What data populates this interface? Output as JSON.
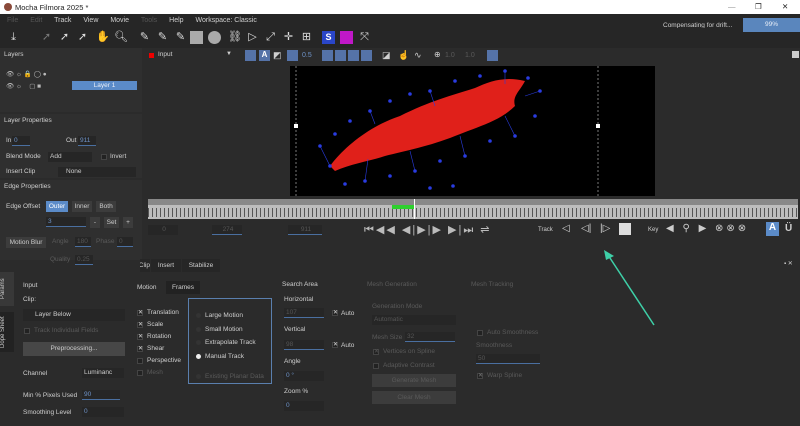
{
  "window": {
    "title": "Mocha Filmora 2025 *",
    "min": "—",
    "max": "❐",
    "close": "✕"
  },
  "menu": [
    "File",
    "Edit",
    "Track",
    "View",
    "Movie",
    "Tools",
    "Help"
  ],
  "workspace": "Workspace: Classic",
  "status": {
    "text": "Compensating for drift...",
    "progress_label": "99%",
    "progress": 99
  },
  "layers": {
    "title": "Layers",
    "items": [
      {
        "name": "Layer 1",
        "selected": true
      }
    ]
  },
  "layer_props": {
    "title": "Layer Properties",
    "in_label": "In",
    "in_value": "0",
    "out_label": "Out",
    "out_value": "911",
    "blend_label": "Blend Mode",
    "blend_value": "Add",
    "invert_label": "Invert",
    "insert_clip_label": "Insert Clip",
    "insert_clip_value": "None"
  },
  "edge_props": {
    "title": "Edge Properties",
    "offset_label": "Edge Offset",
    "outer": "Outer",
    "inner": "Inner",
    "both": "Both",
    "offset_value": "3",
    "minus": "-",
    "set": "Set",
    "plus": "+",
    "motion_blur": "Motion Blur",
    "angle_label": "Angle",
    "angle_value": "180",
    "phase_label": "Phase",
    "phase_value": "0",
    "quality_label": "Quality",
    "quality_value": "0.25"
  },
  "viewer": {
    "clip": "Input",
    "opacity": "0.5",
    "zoom1": "1.0",
    "zoom2": "1.0"
  },
  "transport": {
    "frame_start": "0",
    "frame_cur": "274",
    "frame_end": "911",
    "track_label": "Track",
    "key_label": "Key"
  },
  "module_tabs": [
    "Clip",
    "Insert",
    "Stabilize"
  ],
  "side_tabs": [
    "Params",
    "Dope Sheet"
  ],
  "input": {
    "title": "Input",
    "clip_label": "Clip:",
    "clip_value": "Layer Below",
    "track_fields": "Track Individual Fields",
    "preprocessing": "Preprocessing...",
    "channel_label": "Channel",
    "channel_value": "Luminanc",
    "min_pixels_label": "Min % Pixels Used",
    "min_pixels_value": "90",
    "smoothing_label": "Smoothing Level",
    "smoothing_value": "0"
  },
  "motion": {
    "tabs": [
      "Motion",
      "Frames"
    ],
    "checks": [
      {
        "label": "Translation",
        "on": true
      },
      {
        "label": "Scale",
        "on": true
      },
      {
        "label": "Rotation",
        "on": true
      },
      {
        "label": "Shear",
        "on": true
      },
      {
        "label": "Perspective",
        "on": false
      },
      {
        "label": "Mesh",
        "on": false,
        "disabled": true
      }
    ],
    "radios": [
      {
        "label": "Large Motion",
        "on": false
      },
      {
        "label": "Small Motion",
        "on": false
      },
      {
        "label": "Extrapolate Track",
        "on": false
      },
      {
        "label": "Manual Track",
        "on": true
      },
      {
        "label": "Existing Planar Data",
        "on": false,
        "disabled": true
      }
    ]
  },
  "search": {
    "title": "Search Area",
    "horizontal_label": "Horizontal",
    "horizontal_value": "107",
    "vertical_label": "Vertical",
    "vertical_value": "98",
    "auto": "Auto",
    "angle_label": "Angle",
    "angle_value": "0 °",
    "zoom_label": "Zoom %",
    "zoom_value": "0"
  },
  "mesh_gen": {
    "title": "Mesh Generation",
    "mode_label": "Generation Mode",
    "mode_value": "Automatic",
    "size_label": "Mesh Size",
    "size_value": "32",
    "vertices": "Vertices on Spline",
    "adaptive": "Adaptive Contrast",
    "generate": "Generate Mesh",
    "clear": "Clear Mesh"
  },
  "mesh_track": {
    "title": "Mesh Tracking",
    "auto_smooth": "Auto Smoothness",
    "smooth_label": "Smoothness",
    "smooth_value": "50",
    "warp": "Warp Spline"
  }
}
